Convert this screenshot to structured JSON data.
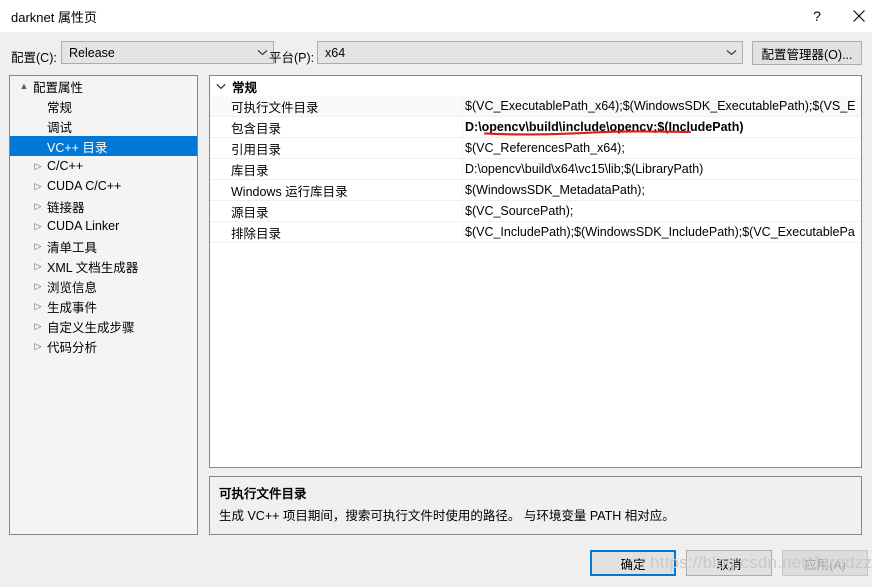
{
  "window": {
    "title": "darknet 属性页",
    "help_icon": "question-mark-icon",
    "close_icon": "close-icon"
  },
  "toolbar": {
    "config_label": "配置(C):",
    "config_value": "Release",
    "platform_label": "平台(P):",
    "platform_value": "x64",
    "config_manager_label": "配置管理器(O)...",
    "chevron_icon": "chevron-down-icon"
  },
  "tree": {
    "items": [
      {
        "label": "配置属性",
        "indent": 0,
        "arrow": "▲",
        "selected": false
      },
      {
        "label": "常规",
        "indent": 1,
        "arrow": "",
        "selected": false
      },
      {
        "label": "调试",
        "indent": 1,
        "arrow": "",
        "selected": false
      },
      {
        "label": "VC++ 目录",
        "indent": 1,
        "arrow": "",
        "selected": true
      },
      {
        "label": "C/C++",
        "indent": 1,
        "arrow": "▷",
        "selected": false
      },
      {
        "label": "CUDA C/C++",
        "indent": 1,
        "arrow": "▷",
        "selected": false
      },
      {
        "label": "链接器",
        "indent": 1,
        "arrow": "▷",
        "selected": false
      },
      {
        "label": "CUDA Linker",
        "indent": 1,
        "arrow": "▷",
        "selected": false
      },
      {
        "label": "清单工具",
        "indent": 1,
        "arrow": "▷",
        "selected": false
      },
      {
        "label": "XML 文档生成器",
        "indent": 1,
        "arrow": "▷",
        "selected": false
      },
      {
        "label": "浏览信息",
        "indent": 1,
        "arrow": "▷",
        "selected": false
      },
      {
        "label": "生成事件",
        "indent": 1,
        "arrow": "▷",
        "selected": false
      },
      {
        "label": "自定义生成步骤",
        "indent": 1,
        "arrow": "▷",
        "selected": false
      },
      {
        "label": "代码分析",
        "indent": 1,
        "arrow": "▷",
        "selected": false
      }
    ]
  },
  "grid": {
    "group_label": "常规",
    "group_chevron": "chevron-down-icon",
    "rows": [
      {
        "name": "可执行文件目录",
        "value": "$(VC_ExecutablePath_x64);$(WindowsSDK_ExecutablePath);$(VS_E",
        "bold": false,
        "highlighted": true
      },
      {
        "name": "包含目录",
        "value": "D:\\opencv\\build\\include\\opencv;$(IncludePath)",
        "bold": true,
        "highlighted": false
      },
      {
        "name": "引用目录",
        "value": "$(VC_ReferencesPath_x64);",
        "bold": false,
        "highlighted": false
      },
      {
        "name": "库目录",
        "value": "D:\\opencv\\build\\x64\\vc15\\lib;$(LibraryPath)",
        "bold": false,
        "highlighted": false
      },
      {
        "name": "Windows 运行库目录",
        "value": "$(WindowsSDK_MetadataPath);",
        "bold": false,
        "highlighted": false
      },
      {
        "name": "源目录",
        "value": "$(VC_SourcePath);",
        "bold": false,
        "highlighted": false
      },
      {
        "name": "排除目录",
        "value": "$(VC_IncludePath);$(WindowsSDK_IncludePath);$(VC_ExecutablePa",
        "bold": false,
        "highlighted": false
      }
    ]
  },
  "annotation": {
    "type": "red-underline",
    "color": "#e01b1b",
    "under_text": "D:\\opencv\\build\\include\\opencv;"
  },
  "description": {
    "title": "可执行文件目录",
    "text": "生成 VC++ 项目期间，搜索可执行文件时使用的路径。  与环境变量 PATH 相对应。"
  },
  "buttons": {
    "ok": "确定",
    "cancel": "取消",
    "apply": "应用(A)"
  },
  "watermark": {
    "text": "https://blog.csdn.net/Jaredzzz"
  }
}
